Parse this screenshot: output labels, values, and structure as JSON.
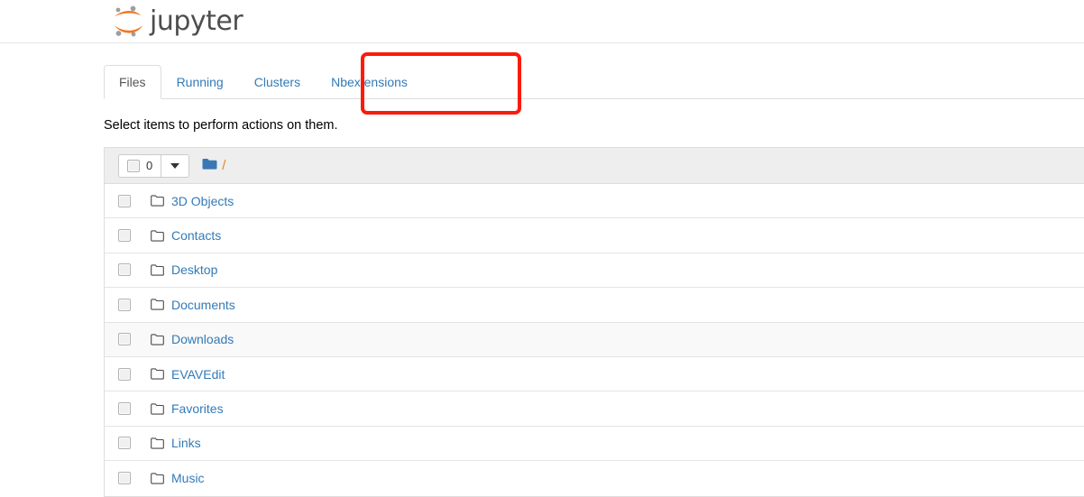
{
  "brand": {
    "name": "jupyter",
    "logo_icon": "jupyter-logo-icon",
    "logo_colors": {
      "arc": "#f37726",
      "dot": "#9e9e9e",
      "wordmark": "#4e4e4e"
    }
  },
  "tabs": [
    {
      "label": "Files",
      "active": true,
      "name": "tab-files"
    },
    {
      "label": "Running",
      "active": false,
      "name": "tab-running"
    },
    {
      "label": "Clusters",
      "active": false,
      "name": "tab-clusters"
    },
    {
      "label": "Nbextensions",
      "active": false,
      "name": "tab-nbextensions"
    }
  ],
  "annotation": {
    "target": "Nbextensions",
    "color": "#fc1a0a"
  },
  "notice": "Select items to perform actions on them.",
  "toolbar": {
    "select_all_checkbox": "select-all-checkbox",
    "selected_count": "0",
    "dropdown_icon": "chevron-down-icon",
    "folder_icon": "folder-icon",
    "breadcrumb_separator": "/",
    "breadcrumb_root": ""
  },
  "files": [
    {
      "name": "3D Objects",
      "type": "folder",
      "hovered": false
    },
    {
      "name": "Contacts",
      "type": "folder",
      "hovered": false
    },
    {
      "name": "Desktop",
      "type": "folder",
      "hovered": false
    },
    {
      "name": "Documents",
      "type": "folder",
      "hovered": false
    },
    {
      "name": "Downloads",
      "type": "folder",
      "hovered": true
    },
    {
      "name": "EVAVEdit",
      "type": "folder",
      "hovered": false
    },
    {
      "name": "Favorites",
      "type": "folder",
      "hovered": false
    },
    {
      "name": "Links",
      "type": "folder",
      "hovered": false
    },
    {
      "name": "Music",
      "type": "folder",
      "hovered": false
    }
  ],
  "colors": {
    "link": "#337ab7",
    "folder_blue": "#3a78b5",
    "slash_orange": "#e08a1e",
    "toolbar_bg": "#eeeeee",
    "hover_row": "#f9f9f9"
  }
}
